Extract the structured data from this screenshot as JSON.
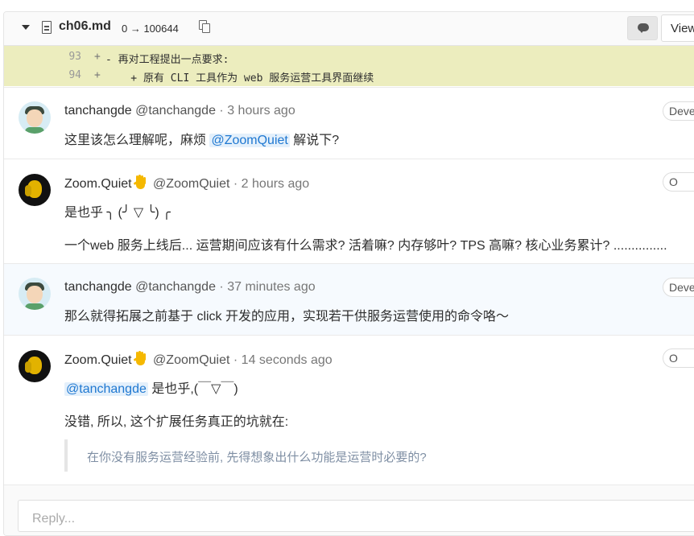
{
  "top_strip": {
    "text_prefix": "",
    "link": ""
  },
  "file": {
    "name": "ch06.md",
    "mode_change": "0 → 100644",
    "view_label": "View"
  },
  "diff": [
    {
      "line": "93",
      "sign": "+",
      "code": "- 再对工程提出一点要求:"
    },
    {
      "line": "94",
      "sign": "+",
      "code": "    + 原有 CLI 工具作为 web 服务运营工具界面继续"
    }
  ],
  "notes": [
    {
      "name": "tanchangde",
      "username": "@tanchangde",
      "ago": "3 hours ago",
      "role": "Deve",
      "text_before": "这里该怎么理解呢，麻烦 ",
      "mention": "@ZoomQuiet",
      "text_after": " 解说下?"
    },
    {
      "name": "Zoom.Quiet",
      "username": "@ZoomQuiet",
      "ago": "2 hours ago",
      "role": "O",
      "line1": "是也乎 ╮ (╯ ▽ ╰) ╭",
      "line2": "一个web 服务上线后... 运营期间应该有什么需求? 活着嘛? 内存够叶? TPS 高嘛? 核心业务累计? ..............."
    },
    {
      "name": "tanchangde",
      "username": "@tanchangde",
      "ago": "37 minutes ago",
      "role": "Deve",
      "text": "那么就得拓展之前基于 click 开发的应用，实现若干供服务运营使用的命令咯～"
    },
    {
      "name": "Zoom.Quiet",
      "username": "@ZoomQuiet",
      "ago": "14 seconds ago",
      "role": "O",
      "mention": "@tanchangde",
      "line1_after": " 是也乎,(￣▽￣)",
      "line2": "没错, 所以, 这个扩展任务真正的坑就在:",
      "quote": "在你没有服务运营经验前, 先得想象出什么功能是运营时必要的?"
    }
  ],
  "reply": {
    "placeholder": "Reply..."
  }
}
